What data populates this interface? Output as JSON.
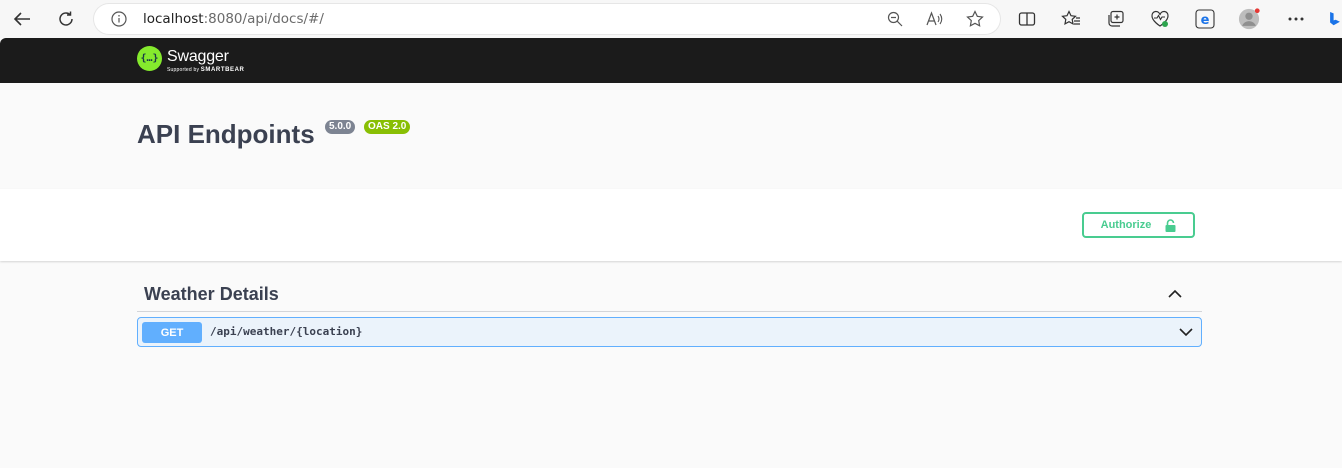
{
  "browser": {
    "url_host": "localhost",
    "url_rest": ":8080/api/docs/#/",
    "icons": [
      "back-arrow-icon",
      "refresh-icon",
      "info-icon",
      "zoom-out-icon",
      "read-aloud-icon",
      "favorite-star-icon",
      "split-screen-icon",
      "favorites-icon",
      "collections-icon",
      "browser-health-icon",
      "edge-icon",
      "profile-avatar-icon",
      "more-menu-icon",
      "bing-icon"
    ]
  },
  "topbar": {
    "logo_symbol": "{…}",
    "logo_name": "Swagger",
    "logo_supported": "Supported by",
    "logo_company": "SMARTBEAR"
  },
  "info": {
    "title": "API Endpoints",
    "version_badge": "5.0.0",
    "oas_badge": "OAS 2.0"
  },
  "scheme": {
    "authorize_label": "Authorize"
  },
  "tag": {
    "name": "Weather Details"
  },
  "operations": [
    {
      "method": "GET",
      "path": "/api/weather/{location}"
    }
  ],
  "colors": {
    "get": "#61affe",
    "authorize": "#49cc90",
    "logo": "#85ea2d",
    "oas_badge": "#89bf04",
    "version_badge": "#7d8492"
  }
}
